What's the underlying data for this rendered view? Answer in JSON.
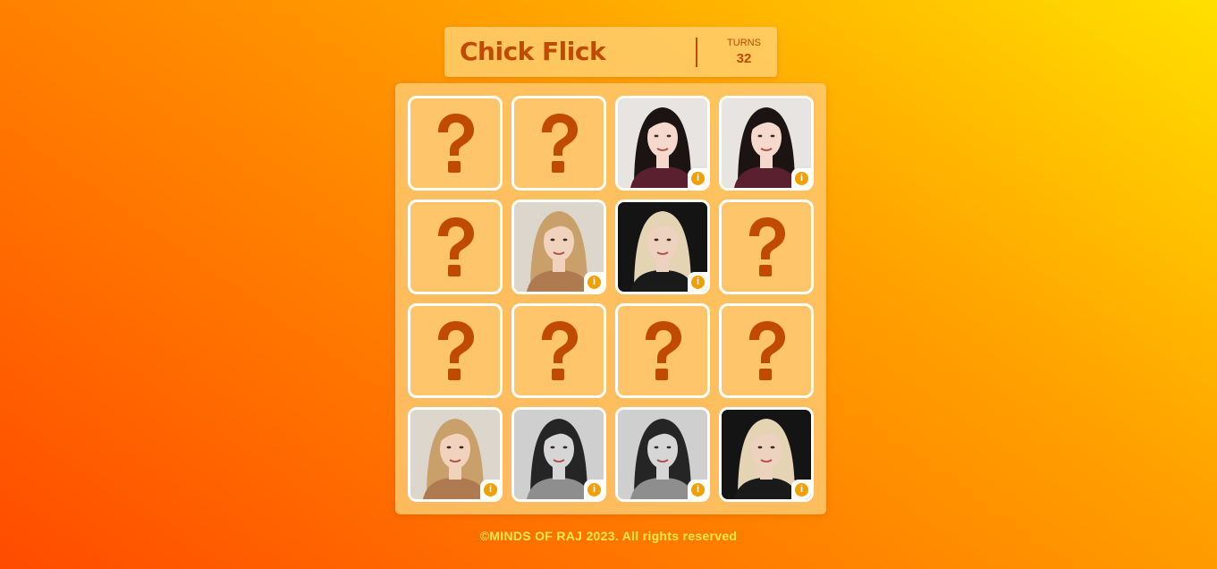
{
  "game": {
    "title": "Chick Flick",
    "turns_label": "TURNS",
    "turns_value": "32"
  },
  "cards": [
    {
      "state": "hidden",
      "symbol": "?"
    },
    {
      "state": "hidden",
      "symbol": "?"
    },
    {
      "state": "revealed",
      "face": "dark-bob-woman",
      "palette": {
        "bg": "#e8e4e2",
        "hair": "#1c1412",
        "skin": "#f4d9cc",
        "top": "#5a2030"
      }
    },
    {
      "state": "revealed",
      "face": "dark-bob-woman",
      "palette": {
        "bg": "#e8e4e2",
        "hair": "#1c1412",
        "skin": "#f4d9cc",
        "top": "#5a2030"
      }
    },
    {
      "state": "hidden",
      "symbol": "?"
    },
    {
      "state": "revealed",
      "face": "wavy-blonde-woman",
      "palette": {
        "bg": "#dcd6cc",
        "hair": "#c9a06a",
        "skin": "#f1d2bd",
        "top": "#b07a50"
      }
    },
    {
      "state": "revealed",
      "face": "platinum-blonde-woman",
      "palette": {
        "bg": "#141414",
        "hair": "#e4d4b4",
        "skin": "#eed2c0",
        "top": "#1a1a1a"
      }
    },
    {
      "state": "hidden",
      "symbol": "?"
    },
    {
      "state": "hidden",
      "symbol": "?"
    },
    {
      "state": "hidden",
      "symbol": "?"
    },
    {
      "state": "hidden",
      "symbol": "?"
    },
    {
      "state": "hidden",
      "symbol": "?"
    },
    {
      "state": "revealed",
      "face": "wavy-blonde-woman",
      "palette": {
        "bg": "#dcd6cc",
        "hair": "#c9a06a",
        "skin": "#f1d2bd",
        "top": "#b07a50"
      }
    },
    {
      "state": "revealed",
      "face": "vintage-bw-woman",
      "palette": {
        "bg": "#cfcfcf",
        "hair": "#252525",
        "skin": "#d6d6d6",
        "top": "#8e8e8e"
      }
    },
    {
      "state": "revealed",
      "face": "vintage-bw-woman",
      "palette": {
        "bg": "#cfcfcf",
        "hair": "#252525",
        "skin": "#d6d6d6",
        "top": "#8e8e8e"
      }
    },
    {
      "state": "revealed",
      "face": "platinum-blonde-woman",
      "palette": {
        "bg": "#141414",
        "hair": "#e4d4b4",
        "skin": "#eed2c0",
        "top": "#1a1a1a"
      }
    }
  ],
  "info_icon": {
    "glyph": "i",
    "name": "info-icon"
  },
  "footer": {
    "copyright": "©MINDS OF RAJ 2023. All rights reserved"
  },
  "colors": {
    "accent": "#c04a00",
    "card_hidden": "#ffc56a",
    "info": "#f0a000",
    "footer_text": "#ffe94d"
  }
}
